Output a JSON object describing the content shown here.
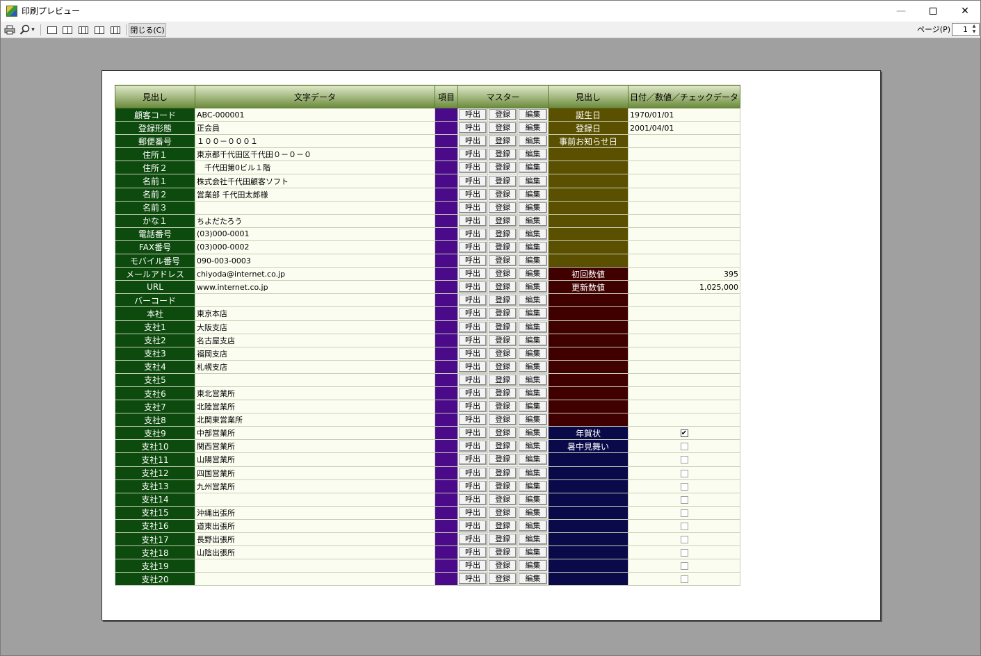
{
  "window": {
    "title": "印刷プレビュー",
    "min_glyph": "—",
    "close_glyph": "✕"
  },
  "toolbar": {
    "close_label": "閉じる(C)",
    "page_label": "ページ(P)",
    "page_value": "1",
    "zoom_caret": "▾"
  },
  "grid": {
    "headers": [
      "見出し",
      "文字データ",
      "項目",
      "マスター",
      "見出し",
      "日付／数値／チェックデータ"
    ],
    "button_labels": [
      "呼出",
      "登録",
      "編集"
    ],
    "rows": [
      {
        "label": "顧客コード",
        "text": "ABC-000001",
        "h2": "誕生日",
        "val": "1970/01/01",
        "kind": "date"
      },
      {
        "label": "登録形態",
        "text": "正会員",
        "h2": "登録日",
        "val": "2001/04/01",
        "kind": "date"
      },
      {
        "label": "郵便番号",
        "text": "１００－０００１",
        "h2": "事前お知らせ日",
        "val": "",
        "kind": "date"
      },
      {
        "label": "住所１",
        "text": "東京都千代田区千代田０－０－０",
        "h2": "",
        "val": "",
        "kind": "date"
      },
      {
        "label": "住所２",
        "text": "　千代田第0ビル１階",
        "h2": "",
        "val": "",
        "kind": "date"
      },
      {
        "label": "名前１",
        "text": "株式会社千代田顧客ソフト",
        "h2": "",
        "val": "",
        "kind": "date"
      },
      {
        "label": "名前２",
        "text": "営業部 千代田太郎様",
        "h2": "",
        "val": "",
        "kind": "date"
      },
      {
        "label": "名前３",
        "text": "",
        "h2": "",
        "val": "",
        "kind": "date"
      },
      {
        "label": "かな１",
        "text": "ちよだたろう",
        "h2": "",
        "val": "",
        "kind": "date"
      },
      {
        "label": "電話番号",
        "text": "(03)000-0001",
        "h2": "",
        "val": "",
        "kind": "date"
      },
      {
        "label": "FAX番号",
        "text": "(03)000-0002",
        "h2": "",
        "val": "",
        "kind": "date"
      },
      {
        "label": "モバイル番号",
        "text": "090-003-0003",
        "h2": "",
        "val": "",
        "kind": "date"
      },
      {
        "label": "メールアドレス",
        "text": "chiyoda@internet.co.jp",
        "h2": "初回数値",
        "val": "395",
        "kind": "num"
      },
      {
        "label": "URL",
        "text": "www.internet.co.jp",
        "h2": "更新数値",
        "val": "1,025,000",
        "kind": "num"
      },
      {
        "label": "バーコード",
        "text": "",
        "h2": "",
        "val": "",
        "kind": "num"
      },
      {
        "label": "本社",
        "text": "東京本店",
        "h2": "",
        "val": "",
        "kind": "num"
      },
      {
        "label": "支社1",
        "text": "大阪支店",
        "h2": "",
        "val": "",
        "kind": "num"
      },
      {
        "label": "支社2",
        "text": "名古屋支店",
        "h2": "",
        "val": "",
        "kind": "num"
      },
      {
        "label": "支社3",
        "text": "福岡支店",
        "h2": "",
        "val": "",
        "kind": "num"
      },
      {
        "label": "支社4",
        "text": "札幌支店",
        "h2": "",
        "val": "",
        "kind": "num"
      },
      {
        "label": "支社5",
        "text": "",
        "h2": "",
        "val": "",
        "kind": "num"
      },
      {
        "label": "支社6",
        "text": "東北営業所",
        "h2": "",
        "val": "",
        "kind": "num"
      },
      {
        "label": "支社7",
        "text": "北陸営業所",
        "h2": "",
        "val": "",
        "kind": "num"
      },
      {
        "label": "支社8",
        "text": "北関東営業所",
        "h2": "",
        "val": "",
        "kind": "num"
      },
      {
        "label": "支社9",
        "text": "中部営業所",
        "h2": "年賀状",
        "val": "",
        "kind": "chk",
        "checked": true
      },
      {
        "label": "支社10",
        "text": "関西営業所",
        "h2": "暑中見舞い",
        "val": "",
        "kind": "chk",
        "checked": false
      },
      {
        "label": "支社11",
        "text": "山陽営業所",
        "h2": "",
        "val": "",
        "kind": "chk",
        "checked": false
      },
      {
        "label": "支社12",
        "text": "四国営業所",
        "h2": "",
        "val": "",
        "kind": "chk",
        "checked": false
      },
      {
        "label": "支社13",
        "text": "九州営業所",
        "h2": "",
        "val": "",
        "kind": "chk",
        "checked": false
      },
      {
        "label": "支社14",
        "text": "",
        "h2": "",
        "val": "",
        "kind": "chk",
        "checked": false
      },
      {
        "label": "支社15",
        "text": "沖縄出張所",
        "h2": "",
        "val": "",
        "kind": "chk",
        "checked": false
      },
      {
        "label": "支社16",
        "text": "道東出張所",
        "h2": "",
        "val": "",
        "kind": "chk",
        "checked": false
      },
      {
        "label": "支社17",
        "text": "長野出張所",
        "h2": "",
        "val": "",
        "kind": "chk",
        "checked": false
      },
      {
        "label": "支社18",
        "text": "山陰出張所",
        "h2": "",
        "val": "",
        "kind": "chk",
        "checked": false
      },
      {
        "label": "支社19",
        "text": "",
        "h2": "",
        "val": "",
        "kind": "chk",
        "checked": false
      },
      {
        "label": "支社20",
        "text": "",
        "h2": "",
        "val": "",
        "kind": "chk",
        "checked": false
      }
    ],
    "colors": {
      "label_bg": "#0d4a0d",
      "item_bg": "#4a0a8a",
      "date_heading_bg": "#5a5000",
      "num_heading_bg": "#400000",
      "chk_heading_bg": "#0a0a4a"
    },
    "checkmark_glyph": "✔"
  }
}
